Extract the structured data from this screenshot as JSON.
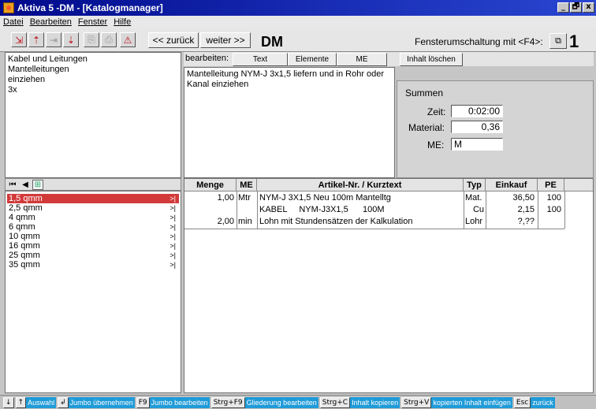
{
  "window": {
    "title": "Aktiva 5 -DM  - [Katalogmanager]",
    "controls": [
      "_",
      "🗗",
      "x"
    ]
  },
  "menu": [
    "Datei",
    "Bearbeiten",
    "Fenster",
    "Hilfe"
  ],
  "toolbar": {
    "back_label": "<< zurück",
    "forward_label": "weiter >>",
    "mode_label": "DM",
    "switch_label": "Fensterumschaltung mit <F4>:",
    "window_number": "1"
  },
  "tree": [
    "Kabel und Leitungen",
    "Mantelleitungen",
    "einziehen",
    "3x"
  ],
  "edit_bar": {
    "label": "bearbeiten:",
    "buttons": [
      "Text",
      "Elemente",
      "ME"
    ],
    "clear_label": "Inhalt löschen"
  },
  "description": "Mantelleitung NYM-J 3x1,5 liefern und in Rohr oder Kanal einziehen",
  "summen": {
    "title": "Summen",
    "zeit_label": "Zeit:",
    "zeit_value": "0:02:00",
    "material_label": "Material:",
    "material_value": "0,36",
    "me_label": "ME:",
    "me_value": "M"
  },
  "list": {
    "items": [
      "1,5 qmm",
      "2,5 qmm",
      "4 qmm",
      "6 qmm",
      "10 qmm",
      "16 qmm",
      "25 qmm",
      "35 qmm"
    ],
    "selected_index": 0,
    "arrow": ">|"
  },
  "table": {
    "headers": [
      "Menge",
      "ME",
      "Artikel-Nr. / Kurztext",
      "Typ",
      "Einkauf",
      "PE"
    ],
    "rows": [
      {
        "menge": "1,00",
        "me": "Mtr",
        "text": "NYM-J 3X1,5 Neu 100m Mantelltg",
        "typ": "Mat.",
        "einkauf": "36,50",
        "pe": "100"
      },
      {
        "menge": "",
        "me": "",
        "text": "KABEL     NYM-J3X1,5      100M",
        "typ": "Cu",
        "einkauf": "2,15",
        "pe": "100"
      },
      {
        "menge": "2,00",
        "me": "min",
        "text": "Lohn mit Stundensätzen der Kalkulation",
        "typ": "Lohr",
        "einkauf": "?,??",
        "pe": ""
      }
    ]
  },
  "statusbar": [
    {
      "key": "↓",
      "text": ""
    },
    {
      "key": "↑",
      "text": "Auswahl"
    },
    {
      "key": "↲",
      "text": "Jumbo übernehmen"
    },
    {
      "key": "F9",
      "text": "Jumbo bearbeiten"
    },
    {
      "key": "Strg+F9",
      "text": "Gliederung bearbeiten"
    },
    {
      "key": "Strg+C",
      "text": "Inhalt kopieren"
    },
    {
      "key": "Strg+V",
      "text": "kopierten Inhalt einfügen"
    },
    {
      "key": "Esc",
      "text": "zurück"
    }
  ]
}
